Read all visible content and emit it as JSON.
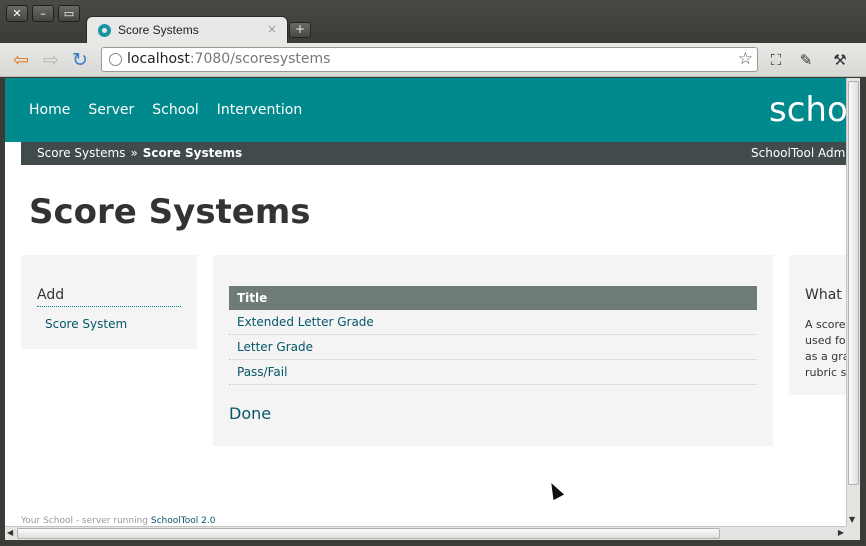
{
  "browser": {
    "tab_title": "Score Systems",
    "tab_close": "×",
    "new_tab": "+",
    "url_host": "localhost",
    "url_rest": ":7080/scoresystems"
  },
  "site": {
    "brand": "schoo",
    "nav": [
      "Home",
      "Server",
      "School",
      "Intervention"
    ],
    "breadcrumb": {
      "parent": "Score Systems",
      "separator": "»",
      "current": "Score Systems"
    },
    "user": "SchoolTool Admin"
  },
  "page": {
    "title": "Score Systems",
    "add_heading": "Add",
    "add_link": "Score System",
    "table": {
      "header": "Title",
      "rows": [
        "Extended Letter Grade",
        "Letter Grade",
        "Pass/Fail"
      ]
    },
    "done": "Done",
    "info_heading": "What i",
    "info_lines": [
      "A score",
      "used fo",
      "as a gra",
      "rubric s"
    ]
  },
  "footer": {
    "text": "Your School - server running",
    "link": "SchoolTool 2.0"
  },
  "colors": {
    "header": "#008a8e",
    "breadcrumb_bar": "#424b4c",
    "table_header": "#6f7b79",
    "link": "#06566b"
  }
}
